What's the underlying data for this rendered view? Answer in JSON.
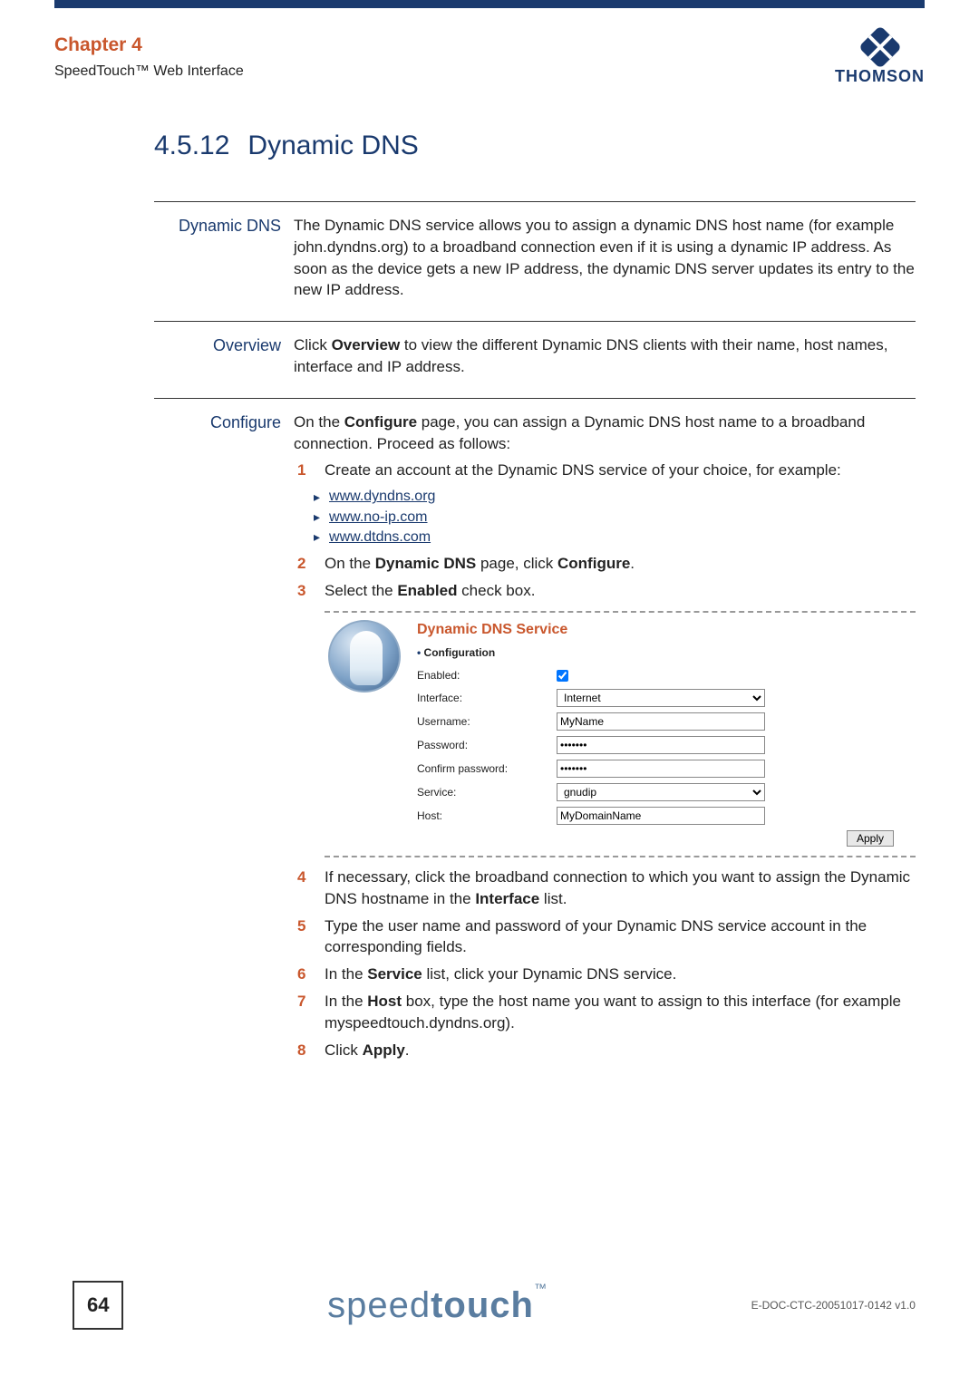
{
  "header": {
    "chapter": "Chapter 4",
    "subtitle": "SpeedTouch™ Web Interface",
    "brand": "THOMSON"
  },
  "section": {
    "number": "4.5.12",
    "title": "Dynamic DNS"
  },
  "rows": {
    "dynamic_dns": {
      "label": "Dynamic DNS",
      "text": "The Dynamic DNS service allows you to assign a dynamic DNS host name (for example john.dyndns.org) to a broadband connection even if it is using a dynamic IP address. As soon as the device gets a new IP address, the dynamic DNS server updates its entry to the new IP address."
    },
    "overview": {
      "label": "Overview",
      "prefix": "Click ",
      "bold": "Overview",
      "suffix": " to view the different Dynamic DNS clients with their name, host names, interface and IP address."
    },
    "configure": {
      "label": "Configure",
      "intro_prefix": "On the ",
      "intro_bold": "Configure",
      "intro_suffix": " page, you can assign a Dynamic DNS host name to a broadband connection. Proceed as follows:"
    }
  },
  "steps": {
    "s1": "Create an account at the Dynamic DNS service of your choice, for example:",
    "links": [
      "www.dyndns.org",
      "www.no-ip.com",
      "www.dtdns.com"
    ],
    "s2_pre": "On the ",
    "s2_b1": "Dynamic DNS",
    "s2_mid": " page, click ",
    "s2_b2": "Configure",
    "s2_end": ".",
    "s3_pre": "Select the ",
    "s3_b": "Enabled",
    "s3_end": " check box.",
    "s4_pre": "If necessary, click the broadband connection to which you want to assign the Dynamic DNS hostname in the ",
    "s4_b": "Interface",
    "s4_end": " list.",
    "s5": "Type the user name and password of your Dynamic DNS service account in the corresponding fields.",
    "s6_pre": "In the ",
    "s6_b": "Service",
    "s6_end": " list, click your Dynamic DNS service.",
    "s7_pre": "In the ",
    "s7_b": "Host",
    "s7_end": " box, type the host name you want to assign to this interface (for example myspeedtouch.dyndns.org).",
    "s8_pre": "Click ",
    "s8_b": "Apply",
    "s8_end": "."
  },
  "screenshot": {
    "title": "Dynamic DNS Service",
    "cfg": "Configuration",
    "labels": {
      "enabled": "Enabled:",
      "interface": "Interface:",
      "username": "Username:",
      "password": "Password:",
      "confirm": "Confirm password:",
      "service": "Service:",
      "host": "Host:"
    },
    "values": {
      "interface": "Internet",
      "username": "MyName",
      "password": "•••••••",
      "confirm": "•••••••",
      "service": "gnudip",
      "host": "MyDomainName"
    },
    "apply": "Apply"
  },
  "footer": {
    "page": "64",
    "brand_light": "speed",
    "brand_bold": "touch",
    "tm": "™",
    "docid": "E-DOC-CTC-20051017-0142 v1.0"
  }
}
